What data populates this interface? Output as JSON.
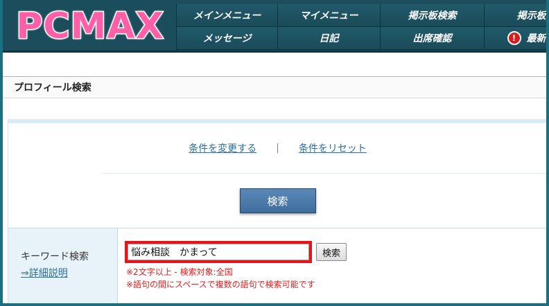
{
  "logo": {
    "text": "PCMAX"
  },
  "nav": {
    "row1": [
      "メインメニュー",
      "マイメニュー",
      "掲示板検索",
      "掲示板投"
    ],
    "row2": [
      "メッセージ",
      "日記",
      "出席確認",
      "最新情報"
    ]
  },
  "section": {
    "title": "プロフィール検索"
  },
  "links": {
    "change_conditions": "条件を変更する",
    "separator": "|",
    "reset_conditions": "条件をリセット"
  },
  "search_button": "検索",
  "keyword": {
    "label": "キーワード検索",
    "detail_link": "⇒詳細説明",
    "input_value": "悩み相談　かまって",
    "button": "検索",
    "note1": "※2文字以上 - 検索対象:全国",
    "note2": "※語句の間にスペースで複数の語句で検索可能です"
  },
  "colors": {
    "header_bg": "#1b4d5c",
    "logo_pink": "#ff5fa8",
    "highlight_red": "#e8141b",
    "link_blue": "#2a6e9b"
  }
}
